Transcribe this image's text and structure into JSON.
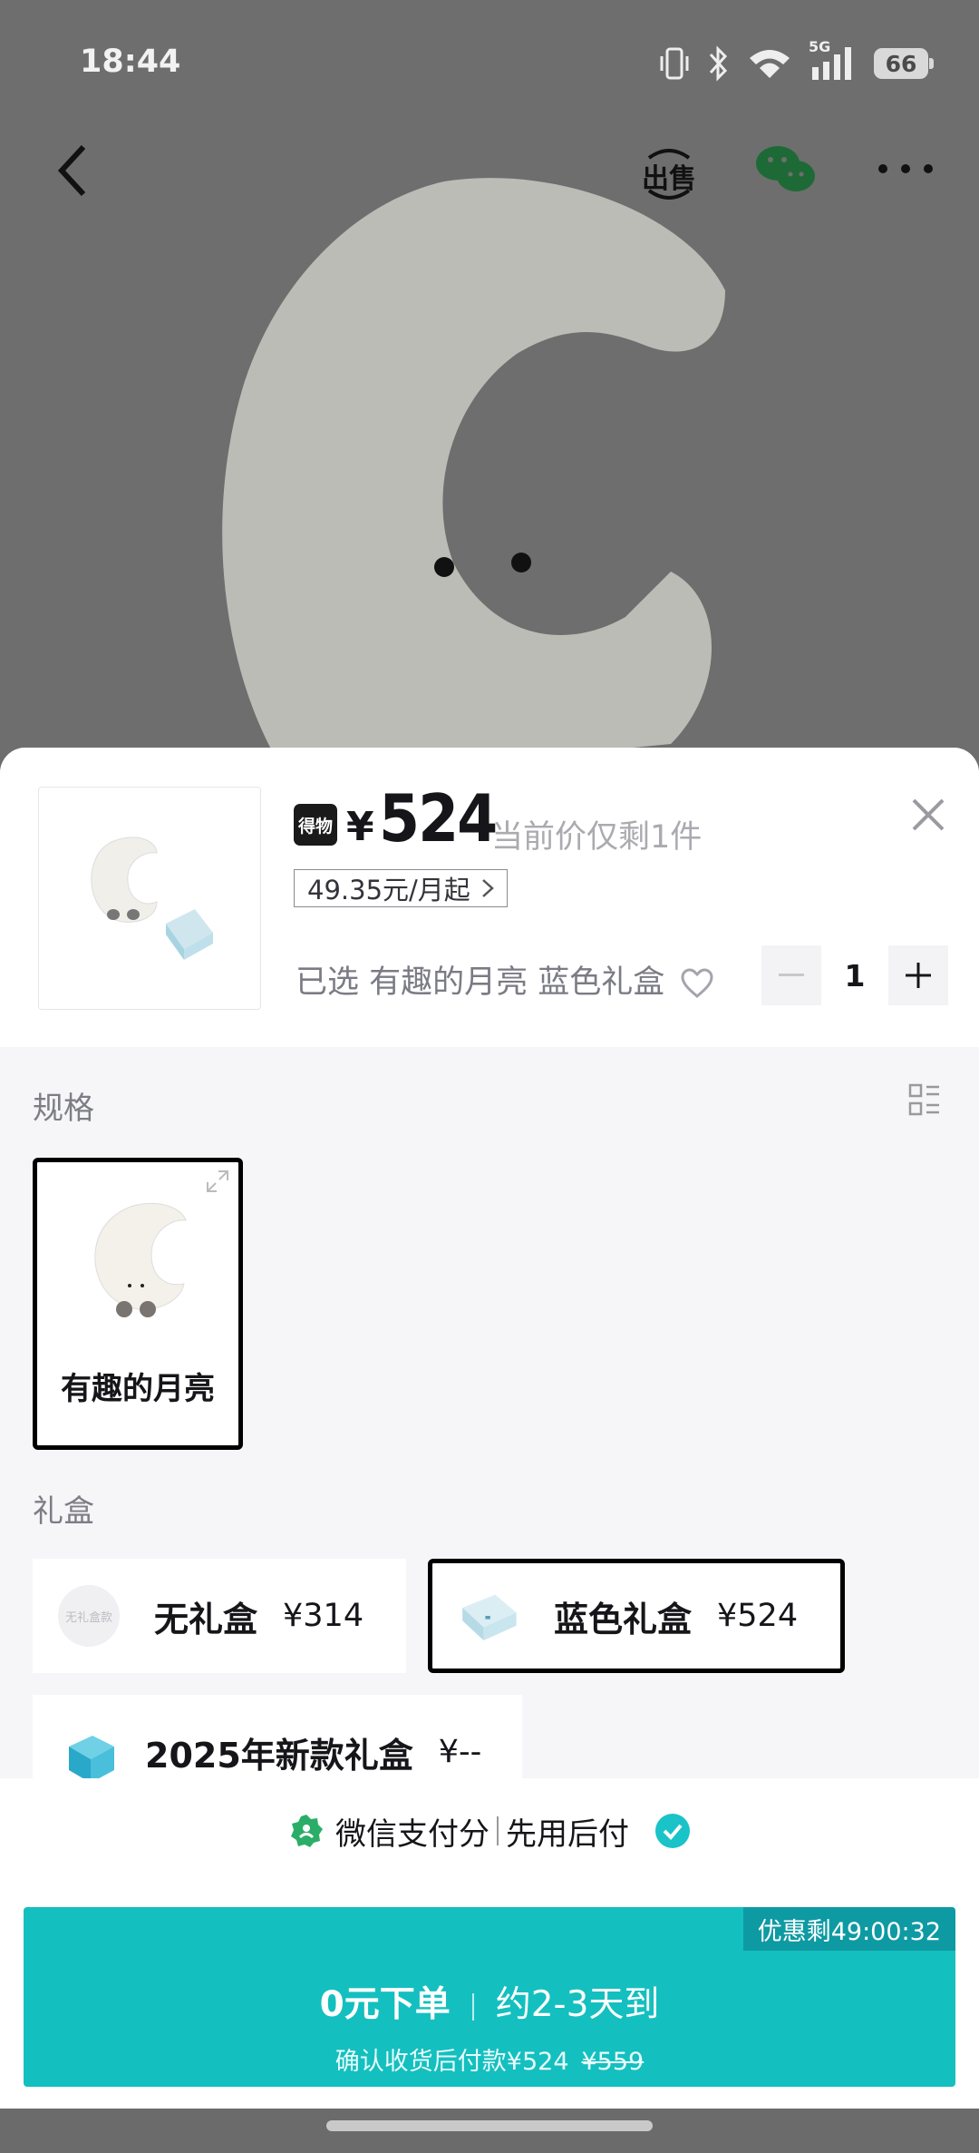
{
  "status_bar": {
    "time": "18:44",
    "battery": "66",
    "network": "5G"
  },
  "header": {
    "sell_label": "出售"
  },
  "product": {
    "price_symbol": "¥",
    "price": "524",
    "stock_note": "当前价仅剩1件",
    "installment": "49.35元/月起",
    "selected_prefix": "已选",
    "selected_value": "有趣的月亮 蓝色礼盒",
    "quantity": "1",
    "brand_badge": "得物"
  },
  "spec_section": {
    "title": "规格",
    "options": [
      {
        "label": "有趣的月亮",
        "selected": true
      }
    ]
  },
  "gift_section": {
    "title": "礼盒",
    "options": [
      {
        "name": "无礼盒",
        "price": "¥314",
        "thumb_text": "无礼盒款",
        "selected": false
      },
      {
        "name": "蓝色礼盒",
        "price": "¥524",
        "selected": true
      },
      {
        "name": "2025年新款礼盒",
        "price": "¥--",
        "selected": false
      }
    ]
  },
  "payment": {
    "method": "微信支付分",
    "mode": "先用后付"
  },
  "cta": {
    "timer": "优惠剩49:00:32",
    "main_left": "0元下单",
    "main_right": "约2-3天到",
    "sub_text": "确认收货后付款¥524",
    "original_price": "¥559"
  },
  "colors": {
    "accent": "#14bfbf",
    "timer_bg": "#0e9aa3",
    "check": "#19c3c8",
    "wechat_green": "#2aae67"
  }
}
